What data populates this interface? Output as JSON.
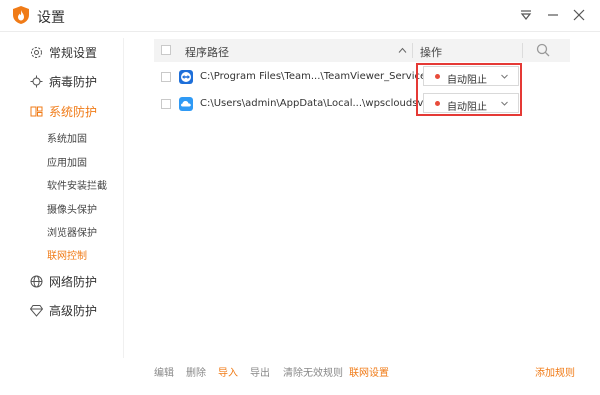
{
  "window": {
    "title": "设置"
  },
  "sidebar": {
    "items": [
      {
        "label": "常规设置",
        "icon": "gear-icon"
      },
      {
        "label": "病毒防护",
        "icon": "virus-icon"
      },
      {
        "label": "系统防护",
        "icon": "system-shield-icon",
        "active": true
      },
      {
        "label": "网络防护",
        "icon": "globe-icon"
      },
      {
        "label": "高级防护",
        "icon": "diamond-icon"
      }
    ],
    "subitems": [
      {
        "label": "系统加固"
      },
      {
        "label": "应用加固"
      },
      {
        "label": "软件安装拦截"
      },
      {
        "label": "摄像头保护"
      },
      {
        "label": "浏览器保护"
      },
      {
        "label": "联网控制",
        "active": true
      }
    ]
  },
  "table": {
    "headers": {
      "path": "程序路径",
      "operation": "操作"
    },
    "rows": [
      {
        "path": "C:\\Program Files\\Team...\\TeamViewer_Service.exe",
        "action": "自动阻止",
        "icon": "teamviewer-icon"
      },
      {
        "path": "C:\\Users\\admin\\AppData\\Local...\\wpscloudsvr.exe",
        "action": "自动阻止",
        "icon": "wps-cloud-icon"
      }
    ]
  },
  "bottombar": {
    "edit": "编辑",
    "delete": "删除",
    "import": "导入",
    "export": "导出",
    "clear_invalid": "清除无效规则",
    "network_settings": "联网设置",
    "add_rule": "添加规则"
  },
  "colors": {
    "accent": "#f07b17",
    "block_dot": "#e84b3a",
    "highlight": "#e53935"
  }
}
